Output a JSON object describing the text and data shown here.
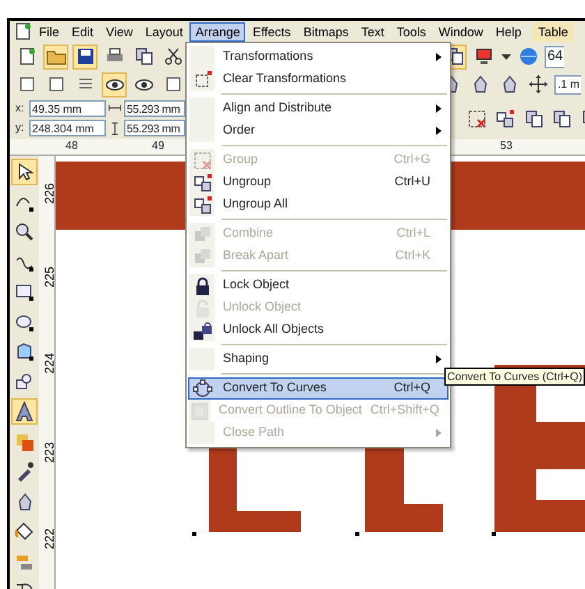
{
  "menu_bar": [
    {
      "label": "File",
      "selected": false
    },
    {
      "label": "Edit",
      "selected": false
    },
    {
      "label": "View",
      "selected": false
    },
    {
      "label": "Layout",
      "selected": false
    },
    {
      "label": "Arrange",
      "selected": true
    },
    {
      "label": "Effects",
      "selected": false
    },
    {
      "label": "Bitmaps",
      "selected": false
    },
    {
      "label": "Text",
      "selected": false
    },
    {
      "label": "Tools",
      "selected": false
    },
    {
      "label": "Window",
      "selected": false
    },
    {
      "label": "Help",
      "selected": false
    },
    {
      "label": "Table",
      "selected": false
    }
  ],
  "toolbar": {
    "zoom_field": "64",
    "nudge_field": ".1 m"
  },
  "property_bar": {
    "x_label": "x:",
    "x_value": "49.35 mm",
    "y_label": "y:",
    "y_value": "248.304 mm",
    "width_value": "55.293 mm",
    "height_value": "55.293 mm"
  },
  "horizontal_ruler": [
    "48",
    "49",
    "53"
  ],
  "vertical_ruler": [
    "226",
    "225",
    "224",
    "223",
    "222"
  ],
  "arrange_menu": [
    {
      "kind": "item",
      "label": "Transformations",
      "submenu": true,
      "disabled": false,
      "selected": false
    },
    {
      "kind": "item",
      "label": "Clear Transformations",
      "submenu": false,
      "disabled": false,
      "selected": false
    },
    {
      "kind": "separator"
    },
    {
      "kind": "item",
      "label": "Align and Distribute",
      "submenu": true,
      "disabled": false,
      "selected": false
    },
    {
      "kind": "item",
      "label": "Order",
      "submenu": true,
      "disabled": false,
      "selected": false
    },
    {
      "kind": "separator"
    },
    {
      "kind": "item",
      "label": "Group",
      "shortcut": "Ctrl+G",
      "submenu": false,
      "disabled": true,
      "selected": false
    },
    {
      "kind": "item",
      "label": "Ungroup",
      "shortcut": "Ctrl+U",
      "submenu": false,
      "disabled": false,
      "selected": false
    },
    {
      "kind": "item",
      "label": "Ungroup All",
      "submenu": false,
      "disabled": false,
      "selected": false
    },
    {
      "kind": "separator"
    },
    {
      "kind": "item",
      "label": "Combine",
      "shortcut": "Ctrl+L",
      "submenu": false,
      "disabled": true,
      "selected": false
    },
    {
      "kind": "item",
      "label": "Break  Apart",
      "shortcut": "Ctrl+K",
      "submenu": false,
      "disabled": true,
      "selected": false
    },
    {
      "kind": "separator"
    },
    {
      "kind": "item",
      "label": "Lock Object",
      "submenu": false,
      "disabled": false,
      "selected": false
    },
    {
      "kind": "item",
      "label": "Unlock Object",
      "submenu": false,
      "disabled": true,
      "selected": false
    },
    {
      "kind": "item",
      "label": "Unlock All Objects",
      "submenu": false,
      "disabled": false,
      "selected": false
    },
    {
      "kind": "separator"
    },
    {
      "kind": "item",
      "label": "Shaping",
      "submenu": true,
      "disabled": false,
      "selected": false
    },
    {
      "kind": "separator"
    },
    {
      "kind": "item",
      "label": "Convert To Curves",
      "shortcut": "Ctrl+Q",
      "submenu": false,
      "disabled": false,
      "selected": true
    },
    {
      "kind": "item",
      "label": "Convert Outline To Object",
      "shortcut": "Ctrl+Shift+Q",
      "submenu": false,
      "disabled": true,
      "selected": false
    },
    {
      "kind": "item",
      "label": "Close Path",
      "submenu": true,
      "disabled": true,
      "selected": false
    }
  ],
  "tooltip": "Convert To Curves (Ctrl+Q)"
}
